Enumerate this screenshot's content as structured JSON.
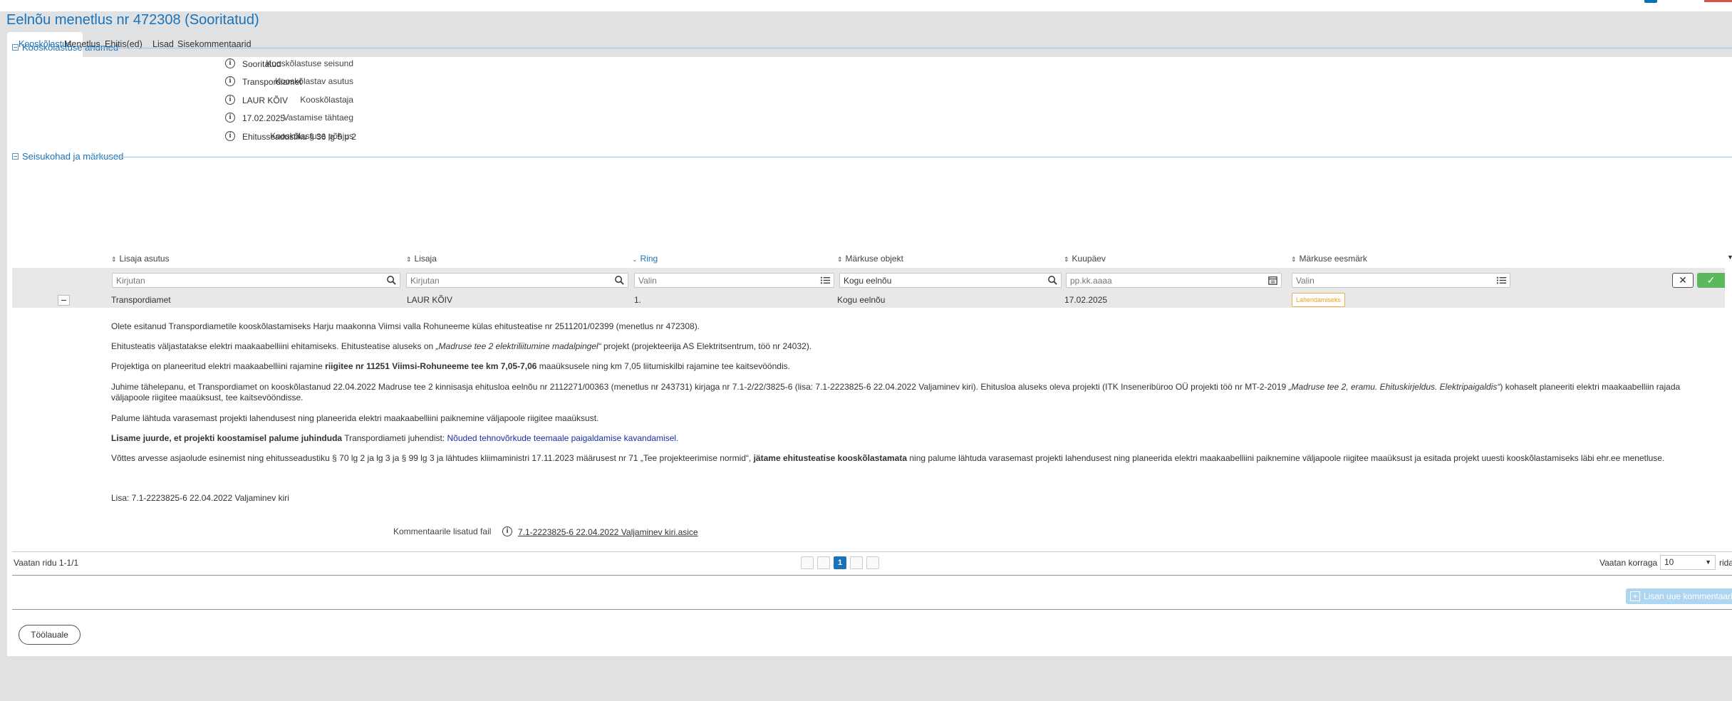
{
  "page_title": "Eelnõu menetlus nr 472308 (Sooritatud)",
  "tabs": [
    {
      "label": "Kooskõlastus",
      "active": true
    },
    {
      "label": "Menetlus",
      "active": false
    },
    {
      "label": "Ehitis(ed)",
      "active": false
    },
    {
      "label": "Lisad",
      "active": false
    },
    {
      "label": "Sisekommentaarid",
      "active": false
    }
  ],
  "section_agreement": {
    "title": "Kooskõlastuse andmed",
    "fields": [
      {
        "label": "Kooskõlastuse seisund",
        "value": "Sooritatud"
      },
      {
        "label": "Kooskõlastav asutus",
        "value": "Transpordiamet"
      },
      {
        "label": "Kooskõlastaja",
        "value": "LAUR KÕIV"
      },
      {
        "label": "Vastamise tähtaeg",
        "value": "17.02.2025"
      },
      {
        "label": "Kooskõlastuse põhjus",
        "value": "Ehitusseadustiku § 36 lg 5 p 2"
      }
    ]
  },
  "section_remarks": {
    "title": "Seisukohad ja märkused",
    "columns": [
      "Lisaja asutus",
      "Lisaja",
      "Ring",
      "Märkuse objekt",
      "Kuupäev",
      "Märkuse eesmärk"
    ],
    "filters": {
      "lisaja_asutus": "Kirjutan",
      "lisaja": "Kirjutan",
      "ring": "Valin",
      "objekt": "Kogu eelnõu",
      "kuupaev": "pp.kk.aaaa",
      "eesmark": "Valin"
    },
    "row": {
      "lisaja_asutus": "Transpordiamet",
      "lisaja": "LAUR KÕIV",
      "ring": "1.",
      "objekt": "Kogu eelnõu",
      "kuupaev": "17.02.2025",
      "eesmark": "Lahendamiseks"
    },
    "comment": {
      "p1": "Olete esitanud Transpordiametile kooskõlastamiseks Harju maakonna Viimsi valla Rohuneeme külas ehitusteatise nr 2511201/02399 (menetlus nr 472308).",
      "p2a": "Ehitusteatis väljastatakse elektri maakaabelliini ehitamiseks. Ehitusteatise aluseks on ",
      "p2b": "„Madruse tee 2 elektriliitumine madalpingel“",
      "p2c": " projekt (projekteerija AS Elektritsentrum, töö nr 24032).",
      "p3a": "Projektiga on planeeritud elektri maakaabelliini rajamine ",
      "p3b": "riigitee nr 11251 Viimsi-Rohuneeme tee km 7,05-7,06",
      "p3c": " maaüksusele ning km 7,05 liitumiskilbi rajamine tee kaitsevööndis.",
      "p4a": "Juhime tähelepanu, et Transpordiamet on kooskõlastanud 22.04.2022 Madruse tee 2 kinnisasja ehitusloa eelnõu nr 2112271/00363 (menetlus nr 243731) kirjaga nr 7.1-2/22/3825-6 (lisa: 7.1-2223825-6 22.04.2022 Valjaminev kiri). Ehitusloa aluseks oleva projekti (ITK Inseneribüroo OÜ projekti töö nr MT-2-2019 ",
      "p4b": "„Madruse tee 2, eramu. Ehituskirjeldus. Elektripaigaldis“",
      "p4c": ") kohaselt planeeriti elektri maakaabelliin rajada väljapoole riigitee maaüksust, tee kaitsevööndisse.",
      "p5": "Palume lähtuda varasemast projekti lahendusest ning planeerida elektri maakaabelliini paiknemine väljapoole riigitee maaüksust.",
      "p6a": "Lisame juurde, et projekti koostamisel palume juhinduda",
      "p6b": " Transpordiameti juhendist: ",
      "p6c": "Nõuded tehnovõrkude teemaale paigaldamise kavandamisel.",
      "p7a": "Võttes arvesse asjaolude esinemist ning ehitusseadustiku § 70 lg 2 ja lg 3 ja § 99 lg 3 ja lähtudes kliimaministri 17.11.2023 määrusest nr 71 „Tee projekteerimise normid“, ",
      "p7b": "jätame ehitusteatise kooskõlastamata",
      "p7c": " ning palume lähtuda varasemast projekti lahendusest ning planeerida elektri maakaabelliini paiknemine väljapoole riigitee maaüksust ja esitada projekt uuesti kooskõlastamiseks läbi ehr.ee menetluse.",
      "p8": "Lisa: 7.1-2223825-6 22.04.2022 Valjaminev kiri"
    },
    "attachment_label": "Kommentaarile lisatud fail",
    "attachment_file": "7.1-2223825-6 22.04.2022 Valjaminev kiri.asice",
    "rows_info": "Vaatan ridu 1-1/1",
    "current_page": "1",
    "per_page_label": "Vaatan korraga",
    "per_page_value": "10",
    "per_page_tail": "rida"
  },
  "add_comment_label": "Lisan uue kommentaari",
  "back_button": "Töölauale",
  "colors": {
    "accent": "#1a73b8",
    "success": "#5cb85c",
    "warning": "#f0ad4e"
  }
}
